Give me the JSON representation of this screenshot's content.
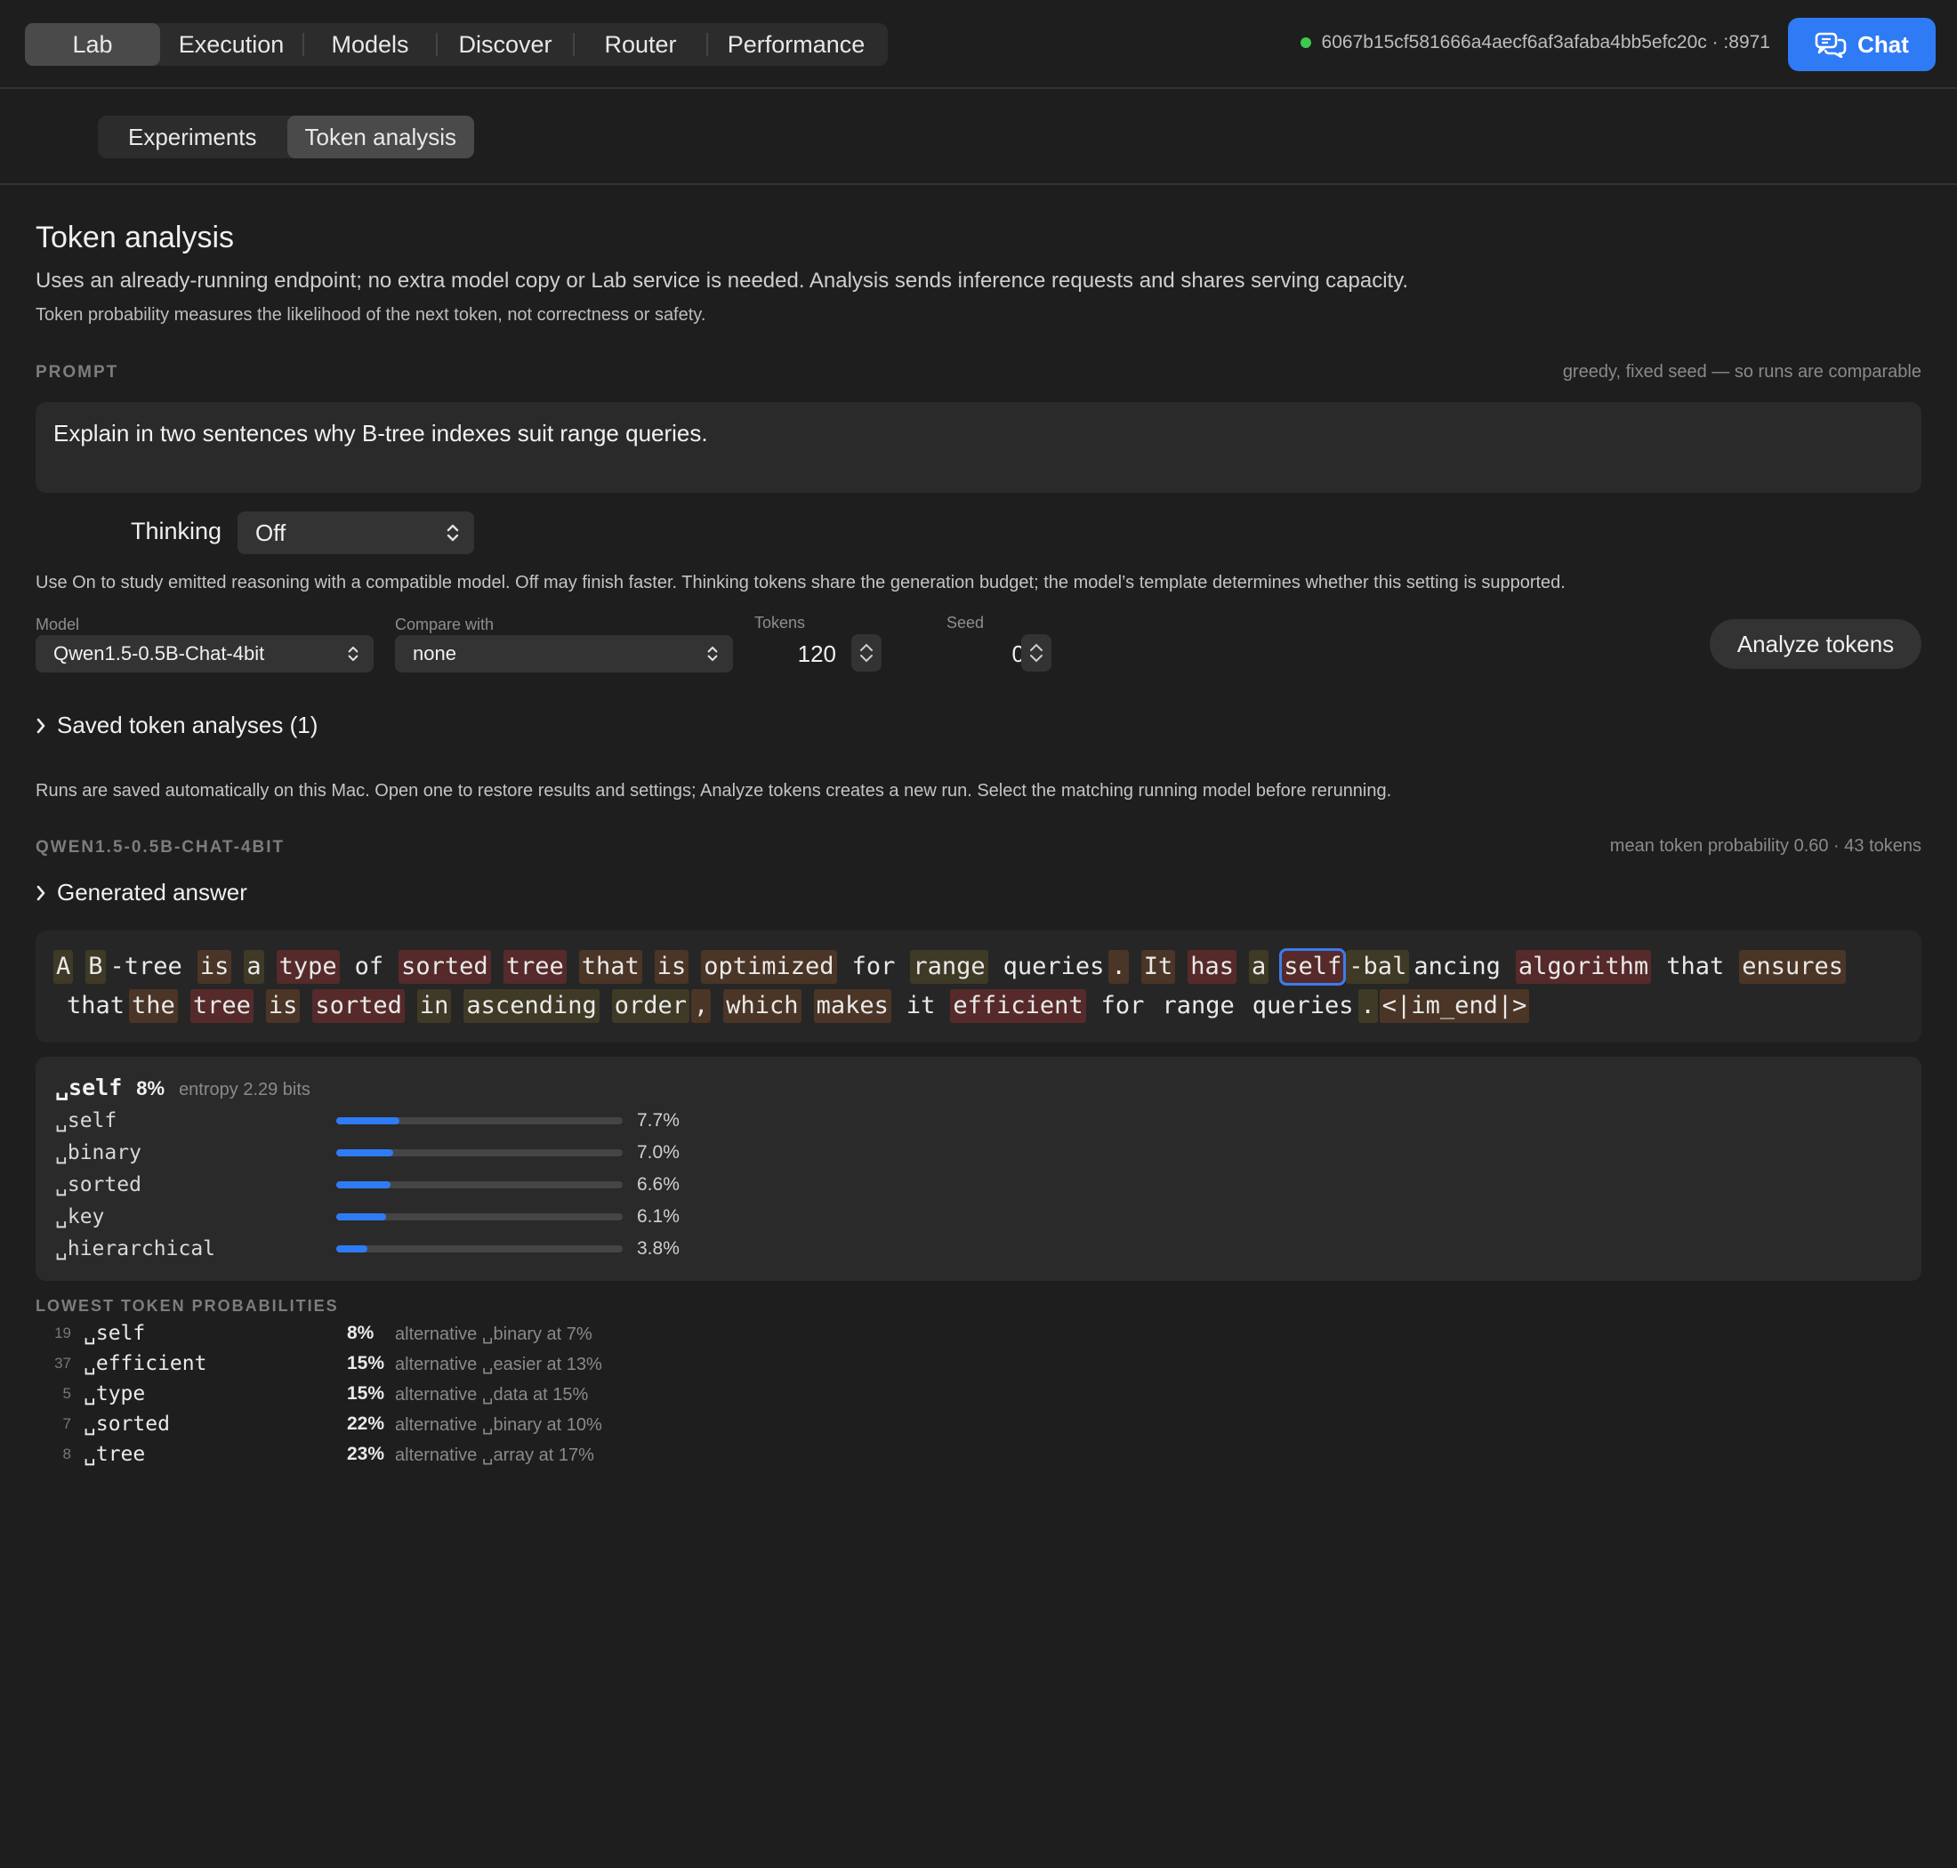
{
  "nav": {
    "tabs": [
      "Lab",
      "Execution",
      "Models",
      "Discover",
      "Router",
      "Performance"
    ],
    "active_tab": "Lab",
    "server": "6067b15cf581666a4aecf6af3afaba4bb5efc20c · :8971",
    "server_status_color": "#3ec94f",
    "chat_label": "Chat",
    "chat_icon": "chat-bubbles-icon"
  },
  "subnav": {
    "tabs": [
      "Experiments",
      "Token analysis"
    ],
    "active_tab": "Token analysis"
  },
  "page": {
    "title": "Token analysis",
    "description": "Uses an already-running endpoint; no extra model copy or Lab service is needed. Analysis sends inference requests and shares serving capacity.",
    "note": "Token probability measures the likelihood of the next token, not correctness or safety."
  },
  "prompt": {
    "label": "PROMPT",
    "right_note": "greedy, fixed seed — so runs are comparable",
    "text": "Explain in two sentences why B-tree indexes suit range queries."
  },
  "thinking": {
    "label": "Thinking",
    "value": "Off",
    "help": "Use On to study emitted reasoning with a compatible model. Off may finish faster. Thinking tokens share the generation budget; the model’s template determines whether this setting is supported."
  },
  "controls": {
    "model_label": "Model",
    "model_value": "Qwen1.5-0.5B-Chat-4bit",
    "compare_label": "Compare with",
    "compare_value": "none",
    "tokens_label": "Tokens",
    "tokens_value": "120",
    "seed_label": "Seed",
    "seed_value": "0",
    "analyze_label": "Analyze tokens"
  },
  "saved": {
    "label": "Saved token analyses (1)",
    "note": "Runs are saved automatically on this Mac. Open one to restore results and settings; Analyze tokens creates a new run. Select the matching running model before rerunning."
  },
  "result": {
    "model_heading": "QWEN1.5-0.5B-CHAT-4BIT",
    "summary": "mean token probability 0.60 · 43 tokens",
    "answer_label": "Generated answer",
    "tokens": [
      {
        "t": "A",
        "lv": 1,
        "sp": false
      },
      {
        "t": "B",
        "lv": 1,
        "sp": true
      },
      {
        "t": "-tree",
        "lv": 0,
        "sp": false
      },
      {
        "t": "is",
        "lv": 2,
        "sp": true
      },
      {
        "t": "a",
        "lv": 1,
        "sp": true
      },
      {
        "t": "type",
        "lv": 3,
        "sp": true
      },
      {
        "t": "of",
        "lv": 0,
        "sp": true
      },
      {
        "t": "sorted",
        "lv": 3,
        "sp": true
      },
      {
        "t": "tree",
        "lv": 3,
        "sp": true
      },
      {
        "t": "that",
        "lv": 2,
        "sp": true
      },
      {
        "t": "is",
        "lv": 2,
        "sp": true
      },
      {
        "t": "optimized",
        "lv": 2,
        "sp": true
      },
      {
        "t": "for",
        "lv": 0,
        "sp": true
      },
      {
        "t": "range",
        "lv": 1,
        "sp": true
      },
      {
        "t": "queries",
        "lv": 0,
        "sp": true
      },
      {
        "t": ".",
        "lv": 2,
        "sp": false
      },
      {
        "t": "It",
        "lv": 2,
        "sp": true
      },
      {
        "t": "has",
        "lv": 3,
        "sp": true
      },
      {
        "t": "a",
        "lv": 1,
        "sp": true
      },
      {
        "t": "self",
        "lv": 3,
        "sp": true,
        "sel": true
      },
      {
        "t": "-bal",
        "lv": 1,
        "sp": false
      },
      {
        "t": "ancing",
        "lv": 0,
        "sp": false
      },
      {
        "t": "algorithm",
        "lv": 3,
        "sp": true
      },
      {
        "t": "that",
        "lv": 0,
        "sp": true
      },
      {
        "t": "ensures",
        "lv": 2,
        "sp": true
      },
      {
        "t": "that",
        "lv": 0,
        "sp": true
      },
      {
        "t": "the",
        "lv": 2,
        "sp": false
      },
      {
        "t": "tree",
        "lv": 3,
        "sp": true
      },
      {
        "t": "is",
        "lv": 2,
        "sp": true
      },
      {
        "t": "sorted",
        "lv": 3,
        "sp": true
      },
      {
        "t": "in",
        "lv": 1,
        "sp": true
      },
      {
        "t": "ascending",
        "lv": 1,
        "sp": true
      },
      {
        "t": "order",
        "lv": 1,
        "sp": true
      },
      {
        "t": ",",
        "lv": 2,
        "sp": false
      },
      {
        "t": "which",
        "lv": 2,
        "sp": true
      },
      {
        "t": "makes",
        "lv": 2,
        "sp": true
      },
      {
        "t": "it",
        "lv": 0,
        "sp": true
      },
      {
        "t": "efficient",
        "lv": 3,
        "sp": true
      },
      {
        "t": "for",
        "lv": 0,
        "sp": true
      },
      {
        "t": "range",
        "lv": 0,
        "sp": true
      },
      {
        "t": "queries",
        "lv": 0,
        "sp": true
      },
      {
        "t": ".",
        "lv": 1,
        "sp": false
      },
      {
        "t": "<|im_end|>",
        "lv": 2,
        "sp": false
      }
    ],
    "selected": {
      "token": "␣self",
      "prob": "8%",
      "entropy": "entropy 2.29 bits",
      "alternatives": [
        {
          "name": "␣self",
          "pct": "7.7%",
          "value": 0.077
        },
        {
          "name": "␣binary",
          "pct": "7.0%",
          "value": 0.07
        },
        {
          "name": "␣sorted",
          "pct": "6.6%",
          "value": 0.066
        },
        {
          "name": "␣key",
          "pct": "6.1%",
          "value": 0.061
        },
        {
          "name": "␣hierarchical",
          "pct": "3.8%",
          "value": 0.038
        }
      ]
    },
    "lowest_label": "LOWEST TOKEN PROBABILITIES",
    "lowest": [
      {
        "idx": "19",
        "tok": "␣self",
        "pct": "8%",
        "alt": "alternative ␣binary at 7%"
      },
      {
        "idx": "37",
        "tok": "␣efficient",
        "pct": "15%",
        "alt": "alternative ␣easier at 13%"
      },
      {
        "idx": "5",
        "tok": "␣type",
        "pct": "15%",
        "alt": "alternative ␣data at 15%"
      },
      {
        "idx": "7",
        "tok": "␣sorted",
        "pct": "22%",
        "alt": "alternative ␣binary at 10%"
      },
      {
        "idx": "8",
        "tok": "␣tree",
        "pct": "23%",
        "alt": "alternative ␣array at 17%"
      }
    ]
  },
  "colors": {
    "accent": "#2f7bf5",
    "low_prob": "#562a2a",
    "mid_prob": "#4a3526",
    "ok_prob": "#3e3a26"
  }
}
